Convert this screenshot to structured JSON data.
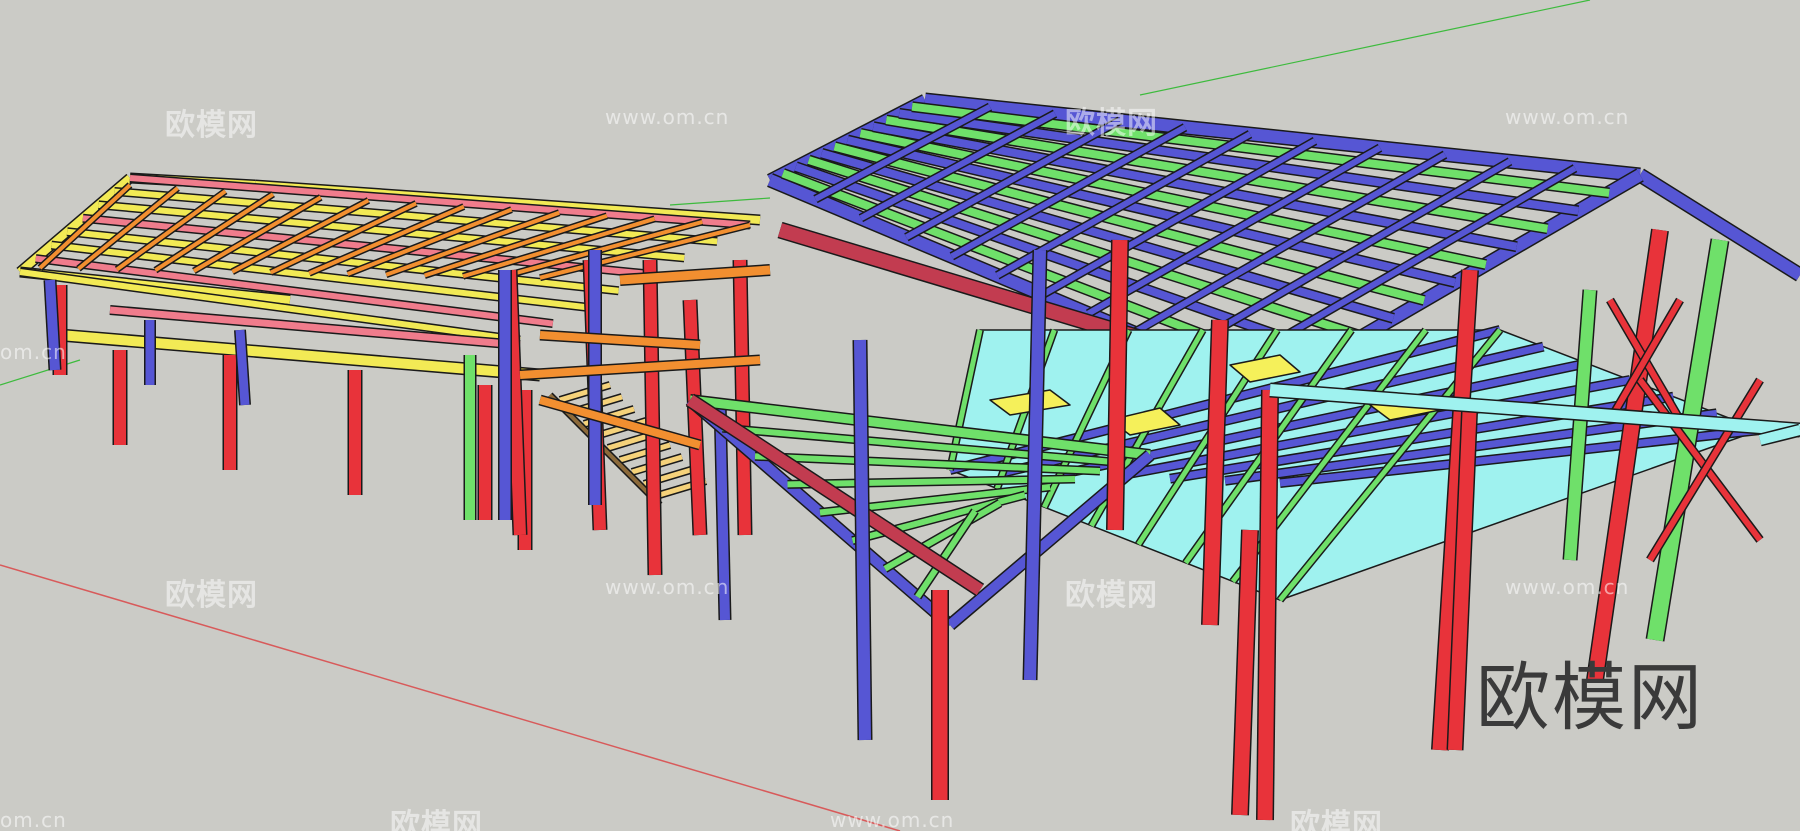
{
  "viewport": {
    "background": "#cbcbc6",
    "axis_colors": {
      "red": "#d85a5a",
      "green": "#3dbb3d"
    }
  },
  "model": {
    "description_colors": {
      "column": "#e8333a",
      "beam_blue": "#5656d4",
      "beam_green": "#6fe06a",
      "beam_yellow": "#f2ea55",
      "beam_orange": "#f28f30",
      "beam_cyan": "#9ff2ef",
      "beam_pink": "#f07c8c",
      "beam_darkred": "#c23c50"
    }
  },
  "watermarks": {
    "cn_text": "欧模网",
    "url_text": "www.om.cn",
    "url_partial": "om.cn"
  },
  "brand_logo": {
    "text": "欧模网"
  }
}
